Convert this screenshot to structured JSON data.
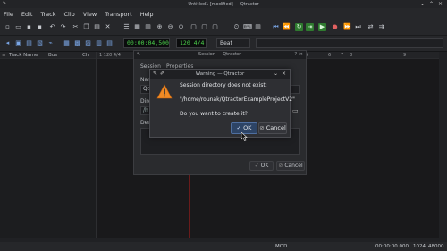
{
  "window": {
    "title": "Untitled1 [modified] — Qtractor",
    "app_icon": "qtractor-icon",
    "controls": [
      "minimize-icon",
      "maximize-icon",
      "close-icon"
    ]
  },
  "menu": {
    "items": [
      "File",
      "Edit",
      "Track",
      "Clip",
      "View",
      "Transport",
      "Help"
    ]
  },
  "transport": {
    "time": "00:00:04,500",
    "tempo": "120 4/4",
    "snap": "Beat"
  },
  "tracklist": {
    "headers": [
      "Track Name",
      "Bus",
      "Ch"
    ]
  },
  "ruler": {
    "marks": [
      "1 120 4/4",
      "5",
      "6",
      "7",
      "8",
      "9"
    ]
  },
  "session_dialog": {
    "title": "Session — Qtractor",
    "tabs": [
      "Session",
      "Properties"
    ],
    "name_label": "Nam",
    "name_value": "Qt",
    "dir_label": "Dire",
    "dir_value": "/h",
    "desc_label": "Desc",
    "ok_label": "OK",
    "cancel_label": "Cancel"
  },
  "warning_dialog": {
    "title": "Warning — Qtractor",
    "line1": "Session directory does not exist:",
    "path": "\"/home/rounak/QtractorExampleProjectV2\"",
    "question": "Do you want to create it?",
    "ok_label": "OK",
    "cancel_label": "Cancel"
  },
  "statusbar": {
    "mode": "MOD",
    "time": "00:00:00.000",
    "buffer": "1024",
    "rate": "48000"
  },
  "colors": {
    "lcd_text": "#4bd14b",
    "warn_icon": "#f08a24",
    "ok_button": "#2d4466"
  }
}
